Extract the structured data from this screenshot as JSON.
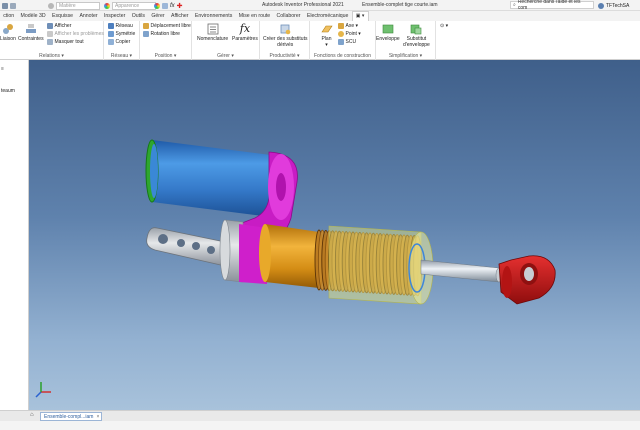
{
  "titlebar": {
    "material_value": "Matière",
    "appearance_value": "Apparence",
    "app_title": "Autodesk Inventor Professional 2021",
    "document_title": "Ensemble-complet tige courte.iam",
    "help_search": "Recherche dans l'aide et les com",
    "user_name": "TFTechSA"
  },
  "tabs": [
    "ction",
    "Modèle 3D",
    "Esquisse",
    "Annoter",
    "Inspecter",
    "Outils",
    "Gérer",
    "Afficher",
    "Environnements",
    "Mise en route",
    "Collaborer",
    "Electromécanique"
  ],
  "ribbon": {
    "relations": {
      "label": "Relations ▾",
      "liaison": "Liaison",
      "contraintes": "Contraintes",
      "afficher": "Afficher",
      "afficher_problemes": "Afficher les problèmes",
      "masquer_tout": "Masquer tout"
    },
    "reseau": {
      "label": "Réseau ▾",
      "reseau": "Réseau",
      "symetrie": "Symétrie",
      "copier": "Copier"
    },
    "position": {
      "label": "Position ▾",
      "deplacement": "Déplacement libre",
      "rotation": "Rotation libre"
    },
    "gerer": {
      "label": "Gérer ▾",
      "nomenclature": "Nomenclature",
      "parametres": "Paramètres"
    },
    "productivite": {
      "label": "Productivité ▾",
      "substituts_line1": "Créer des substituts",
      "substituts_line2": "dérivés"
    },
    "fonctions": {
      "label": "Fonctions de construction",
      "plan": "Plan",
      "axe": "Axe ▾",
      "point": "Point ▾",
      "scu": "SCU"
    },
    "simplification": {
      "label": "Simplification ▾",
      "enveloppe": "Enveloppe",
      "substitut_line1": "Substitut",
      "substitut_line2": "d'enveloppe"
    }
  },
  "browser": {
    "partial_label": "teaum"
  },
  "bottombar": {
    "doc_tab": "Ensemble-compl...iam"
  },
  "colors": {
    "viewport_top": "#3f5f8a",
    "viewport_bottom": "#a8c2db",
    "cylinder_blue": "#3a85d8",
    "accent_magenta": "#d41fcf",
    "spring_orange": "#e3a01f",
    "end_red": "#d11a1a",
    "translucent_yellow": "#e8e88a"
  }
}
